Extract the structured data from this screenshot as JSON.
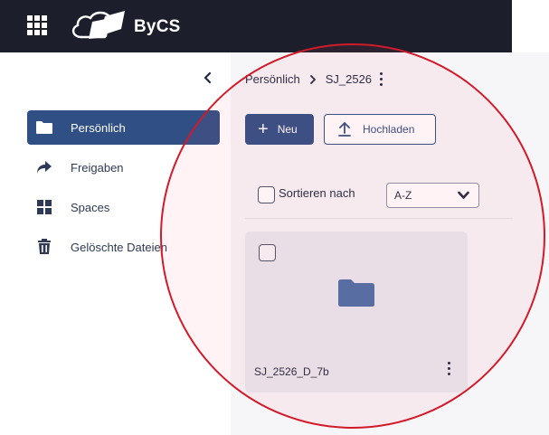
{
  "topbar": {
    "brand": "ByCS",
    "apps_icon": "grid-apps-icon",
    "logo_icon": "cloud-folder-logo-icon",
    "bg_color": "#1c1f2b"
  },
  "sidebar": {
    "collapse_icon": "chevron-left-icon",
    "items": [
      {
        "label": "Persönlich",
        "icon": "folder-icon",
        "active": true
      },
      {
        "label": "Freigaben",
        "icon": "share-arrow-icon",
        "active": false
      },
      {
        "label": "Spaces",
        "icon": "grid-squares-icon",
        "active": false
      },
      {
        "label": "Gelöschte Dateien",
        "icon": "trash-icon",
        "active": false
      }
    ],
    "active_color": "#2f4f85"
  },
  "breadcrumb": {
    "root": "Persönlich",
    "current": "SJ_2526"
  },
  "toolbar": {
    "new_label": "Neu",
    "upload_label": "Hochladen"
  },
  "sort": {
    "label": "Sortieren nach",
    "selected": "A-Z"
  },
  "files": [
    {
      "name": "SJ_2526_D_7b",
      "type": "folder",
      "icon": "folder-icon"
    }
  ],
  "annotation": {
    "color": "#d11a2a"
  }
}
